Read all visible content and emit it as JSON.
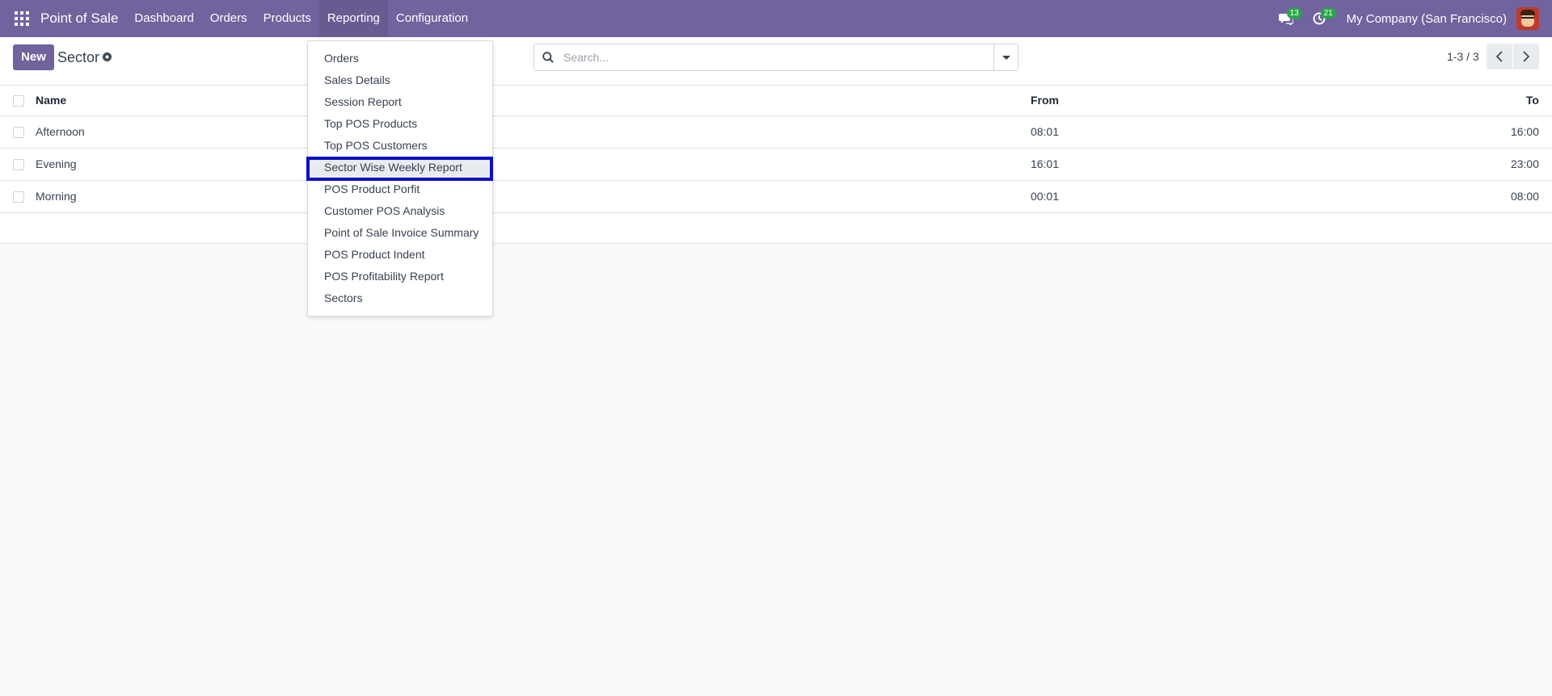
{
  "navbar": {
    "brand": "Point of Sale",
    "menu": [
      "Dashboard",
      "Orders",
      "Products",
      "Reporting",
      "Configuration"
    ],
    "active_menu": "Reporting",
    "messages_badge": "13",
    "activities_badge": "21",
    "company": "My Company (San Francisco)"
  },
  "control": {
    "new_label": "New",
    "breadcrumb": "Sector",
    "search_placeholder": "Search...",
    "pager": "1-3 / 3"
  },
  "table": {
    "columns": [
      "Name",
      "From",
      "To"
    ],
    "rows": [
      {
        "name": "Afternoon",
        "from": "08:01",
        "to": "16:00"
      },
      {
        "name": "Evening",
        "from": "16:01",
        "to": "23:00"
      },
      {
        "name": "Morning",
        "from": "00:01",
        "to": "08:00"
      }
    ]
  },
  "reporting_menu": {
    "items": [
      "Orders",
      "Sales Details",
      "Session Report",
      "Top POS Products",
      "Top POS Customers",
      "Sector Wise Weekly Report",
      "POS Product Porfit",
      "Customer POS Analysis",
      "Point of Sale Invoice Summary",
      "POS Product Indent",
      "POS Profitability Report",
      "Sectors"
    ],
    "highlighted": "Sector Wise Weekly Report"
  },
  "colors": {
    "brand": "#71639e",
    "highlight_border": "#0a10c8",
    "badge": "#28a745"
  }
}
